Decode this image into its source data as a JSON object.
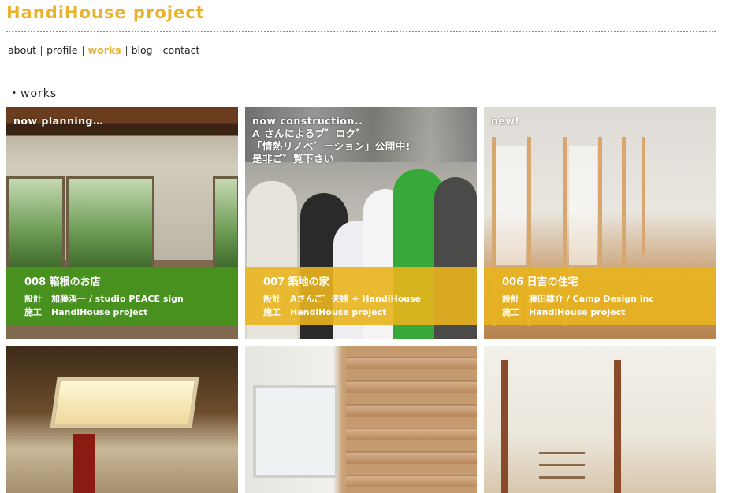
{
  "site": {
    "title": "HandiHouse project"
  },
  "nav": {
    "items": [
      "about",
      "profile",
      "works",
      "blog",
      "contact"
    ],
    "active": "works"
  },
  "section": {
    "title": "・works"
  },
  "colors": {
    "accent": "#eab12e",
    "green_band": "#429619",
    "yellow_band": "#e9b41e"
  },
  "works": [
    {
      "status": "now planning…",
      "number_title": "008  箱根のお店",
      "design_label": "設計",
      "design": "加藤渓一 / studio PEACE sign",
      "build_label": "施工",
      "build": "HandiHouse project",
      "band_color": "green"
    },
    {
      "status": "now construction..\nA さんによるブ゛ロク゛\n「情熱リノベ゛ーション」公開中!\n是非ご゛覧下さい",
      "number_title": "007  築地の家",
      "design_label": "設計",
      "design": "Aさんご゛夫婦 + HandiHouse",
      "build_label": "施工",
      "build": "HandiHouse project",
      "band_color": "yellow"
    },
    {
      "status": "new!",
      "number_title": "006  日吉の住宅",
      "design_label": "設計",
      "design": "藤田雄介 / Camp Design inc",
      "build_label": "施工",
      "build": "HandiHouse project",
      "band_color": "yellow"
    }
  ]
}
